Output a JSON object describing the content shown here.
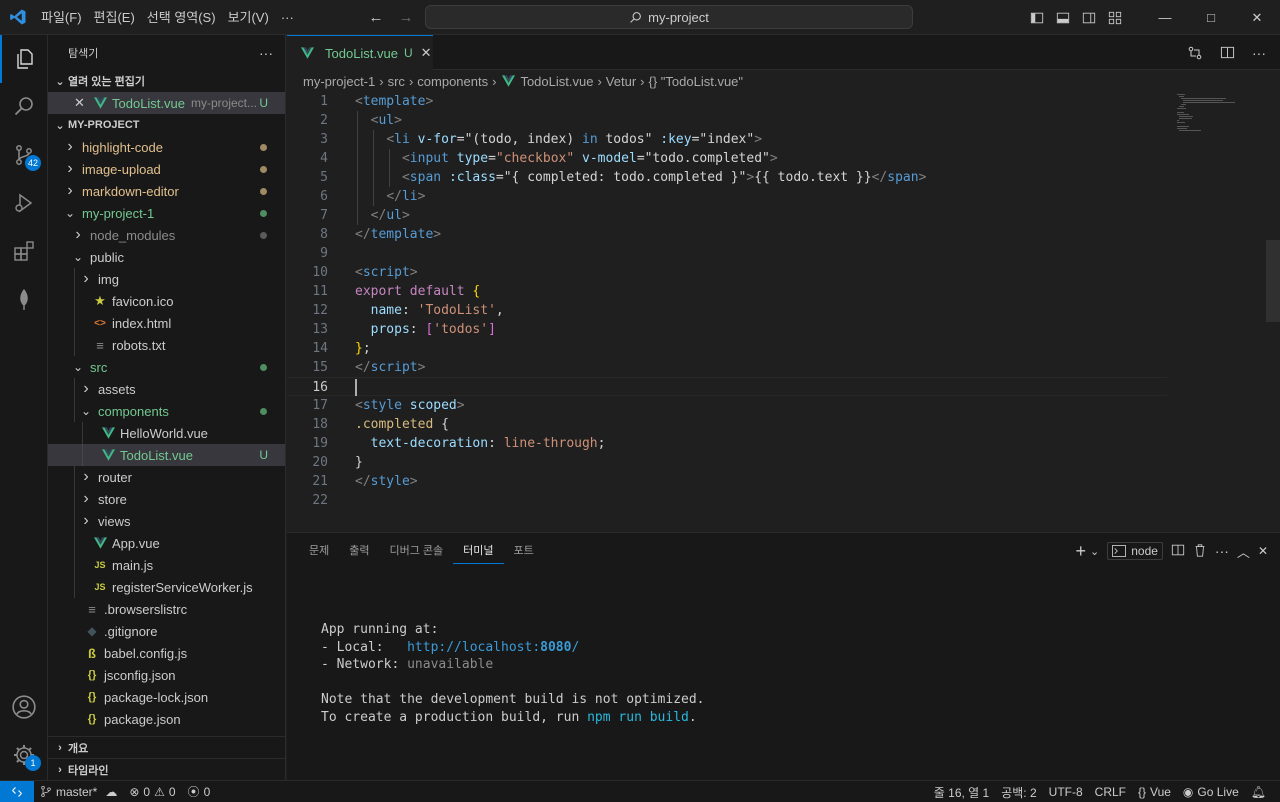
{
  "titlebar": {
    "menus": [
      "파일(F)",
      "편집(E)",
      "선택 영역(S)",
      "보기(V)",
      "···"
    ],
    "search_text": "my-project"
  },
  "activitybar": {
    "source_control_badge": "42",
    "settings_badge": "1"
  },
  "explorer": {
    "title": "탐색기",
    "open_editors_label": "열려 있는 편집기",
    "open_editor": {
      "name": "TodoList.vue",
      "desc": "my-project...",
      "status": "U"
    },
    "project_label": "MY-PROJECT",
    "outline_label": "개요",
    "timeline_label": "타임라인",
    "tree": [
      {
        "name": "highlight-code",
        "type": "folder",
        "indent": 0,
        "color": "orange",
        "dot": "#a08a63"
      },
      {
        "name": "image-upload",
        "type": "folder",
        "indent": 0,
        "color": "orange",
        "dot": "#a08a63"
      },
      {
        "name": "markdown-editor",
        "type": "folder",
        "indent": 0,
        "color": "orange",
        "dot": "#a08a63"
      },
      {
        "name": "my-project-1",
        "type": "folder-open",
        "indent": 0,
        "color": "green",
        "dot": "#4f8e60"
      },
      {
        "name": "node_modules",
        "type": "folder",
        "indent": 1,
        "color": "grey",
        "dot": "#5a5a5a"
      },
      {
        "name": "public",
        "type": "folder-open",
        "indent": 1,
        "color": "plain"
      },
      {
        "name": "img",
        "type": "folder",
        "indent": 2,
        "color": "plain"
      },
      {
        "name": "favicon.ico",
        "type": "file",
        "icon": "star",
        "indent": 2,
        "color": "plain"
      },
      {
        "name": "index.html",
        "type": "file",
        "icon": "html",
        "indent": 2,
        "color": "plain"
      },
      {
        "name": "robots.txt",
        "type": "file",
        "icon": "lines",
        "indent": 2,
        "color": "plain"
      },
      {
        "name": "src",
        "type": "folder-open",
        "indent": 1,
        "color": "green",
        "dot": "#4f8e60"
      },
      {
        "name": "assets",
        "type": "folder",
        "indent": 2,
        "color": "plain"
      },
      {
        "name": "components",
        "type": "folder-open",
        "indent": 2,
        "color": "green",
        "dot": "#4f8e60"
      },
      {
        "name": "HelloWorld.vue",
        "type": "file",
        "icon": "vue",
        "indent": 3,
        "color": "plain"
      },
      {
        "name": "TodoList.vue",
        "type": "file",
        "icon": "vue",
        "indent": 3,
        "color": "green",
        "status": "U",
        "selected": true
      },
      {
        "name": "router",
        "type": "folder",
        "indent": 2,
        "color": "plain"
      },
      {
        "name": "store",
        "type": "folder",
        "indent": 2,
        "color": "plain"
      },
      {
        "name": "views",
        "type": "folder",
        "indent": 2,
        "color": "plain"
      },
      {
        "name": "App.vue",
        "type": "file",
        "icon": "vue",
        "indent": 2,
        "color": "plain"
      },
      {
        "name": "main.js",
        "type": "file",
        "icon": "js",
        "indent": 2,
        "color": "plain"
      },
      {
        "name": "registerServiceWorker.js",
        "type": "file",
        "icon": "js",
        "indent": 2,
        "color": "plain"
      },
      {
        "name": ".browserslistrc",
        "type": "file",
        "icon": "lines",
        "indent": 1,
        "color": "plain"
      },
      {
        "name": ".gitignore",
        "type": "file",
        "icon": "git",
        "indent": 1,
        "color": "plain"
      },
      {
        "name": "babel.config.js",
        "type": "file",
        "icon": "babel",
        "indent": 1,
        "color": "plain"
      },
      {
        "name": "jsconfig.json",
        "type": "file",
        "icon": "json",
        "indent": 1,
        "color": "plain"
      },
      {
        "name": "package-lock.json",
        "type": "file",
        "icon": "json",
        "indent": 1,
        "color": "plain"
      },
      {
        "name": "package.json",
        "type": "file",
        "icon": "json",
        "indent": 1,
        "color": "plain"
      }
    ]
  },
  "editor": {
    "tab_name": "TodoList.vue",
    "tab_status": "U",
    "breadcrumb": [
      "my-project-1",
      "src",
      "components",
      "TodoList.vue",
      "Vetur",
      "{} \"TodoList.vue\""
    ],
    "current_line": 16,
    "lines": [
      [
        [
          "t-br",
          "<"
        ],
        [
          "t-tag",
          "template"
        ],
        [
          "t-br",
          ">"
        ]
      ],
      [
        [
          "t-plain",
          "  "
        ],
        [
          "t-br",
          "<"
        ],
        [
          "t-tag",
          "ul"
        ],
        [
          "t-br",
          ">"
        ]
      ],
      [
        [
          "t-plain",
          "    "
        ],
        [
          "t-br",
          "<"
        ],
        [
          "t-tag",
          "li"
        ],
        [
          "t-plain",
          " "
        ],
        [
          "t-attr",
          "v-for"
        ],
        [
          "t-plain",
          "="
        ],
        [
          "t-plain",
          "\"(todo, index) "
        ],
        [
          "t-key",
          "in"
        ],
        [
          "t-plain",
          " todos\""
        ],
        [
          "t-plain",
          " "
        ],
        [
          "t-attr",
          ":key"
        ],
        [
          "t-plain",
          "=\"index\""
        ],
        [
          "t-br",
          ">"
        ]
      ],
      [
        [
          "t-plain",
          "      "
        ],
        [
          "t-br",
          "<"
        ],
        [
          "t-tag",
          "input"
        ],
        [
          "t-plain",
          " "
        ],
        [
          "t-attr",
          "type"
        ],
        [
          "t-plain",
          "="
        ],
        [
          "t-str",
          "\"checkbox\""
        ],
        [
          "t-plain",
          " "
        ],
        [
          "t-attr",
          "v-model"
        ],
        [
          "t-plain",
          "=\"todo.completed\""
        ],
        [
          "t-br",
          ">"
        ]
      ],
      [
        [
          "t-plain",
          "      "
        ],
        [
          "t-br",
          "<"
        ],
        [
          "t-tag",
          "span"
        ],
        [
          "t-plain",
          " "
        ],
        [
          "t-attr",
          ":class"
        ],
        [
          "t-plain",
          "=\"{ completed: todo.completed }\""
        ],
        [
          "t-br",
          ">"
        ],
        [
          "t-plain",
          "{{ todo.text }}"
        ],
        [
          "t-br",
          "</"
        ],
        [
          "t-tag",
          "span"
        ],
        [
          "t-br",
          ">"
        ]
      ],
      [
        [
          "t-plain",
          "    "
        ],
        [
          "t-br",
          "</"
        ],
        [
          "t-tag",
          "li"
        ],
        [
          "t-br",
          ">"
        ]
      ],
      [
        [
          "t-plain",
          "  "
        ],
        [
          "t-br",
          "</"
        ],
        [
          "t-tag",
          "ul"
        ],
        [
          "t-br",
          ">"
        ]
      ],
      [
        [
          "t-br",
          "</"
        ],
        [
          "t-tag",
          "template"
        ],
        [
          "t-br",
          ">"
        ]
      ],
      [],
      [
        [
          "t-br",
          "<"
        ],
        [
          "t-tag",
          "script"
        ],
        [
          "t-br",
          ">"
        ]
      ],
      [
        [
          "t-kw",
          "export"
        ],
        [
          "t-plain",
          " "
        ],
        [
          "t-kw",
          "default"
        ],
        [
          "t-plain",
          " "
        ],
        [
          "t-brace",
          "{"
        ]
      ],
      [
        [
          "t-plain",
          "  "
        ],
        [
          "t-prop",
          "name"
        ],
        [
          "t-plain",
          ": "
        ],
        [
          "t-str",
          "'TodoList'"
        ],
        [
          "t-plain",
          ","
        ]
      ],
      [
        [
          "t-plain",
          "  "
        ],
        [
          "t-prop",
          "props"
        ],
        [
          "t-plain",
          ": "
        ],
        [
          "t-brace2",
          "["
        ],
        [
          "t-str",
          "'todos'"
        ],
        [
          "t-brace2",
          "]"
        ]
      ],
      [
        [
          "t-brace",
          "}"
        ],
        [
          "t-plain",
          ";"
        ]
      ],
      [
        [
          "t-br",
          "</"
        ],
        [
          "t-tag",
          "script"
        ],
        [
          "t-br",
          ">"
        ]
      ],
      [],
      [
        [
          "t-br",
          "<"
        ],
        [
          "t-tag",
          "style"
        ],
        [
          "t-plain",
          " "
        ],
        [
          "t-attr",
          "scoped"
        ],
        [
          "t-br",
          ">"
        ]
      ],
      [
        [
          "t-sel",
          ".completed"
        ],
        [
          "t-plain",
          " {"
        ]
      ],
      [
        [
          "t-plain",
          "  "
        ],
        [
          "t-prop",
          "text-decoration"
        ],
        [
          "t-plain",
          ": "
        ],
        [
          "t-str",
          "line-through"
        ],
        [
          "t-plain",
          ";"
        ]
      ],
      [
        [
          "t-plain",
          "}"
        ]
      ],
      [
        [
          "t-br",
          "</"
        ],
        [
          "t-tag",
          "style"
        ],
        [
          "t-br",
          ">"
        ]
      ],
      []
    ]
  },
  "panel": {
    "tabs": [
      "문제",
      "출력",
      "디버그 콘솔",
      "터미널",
      "포트"
    ],
    "active_tab": "터미널",
    "terminal_name": "node",
    "terminal": {
      "l1": "App running at:",
      "l2_label": "- Local:   ",
      "l2_url": "http://localhost:",
      "l2_port": "8080",
      "l2_end": "/",
      "l3_label": "- Network: ",
      "l3_value": "unavailable",
      "l4": "Note that the development build is not optimized.",
      "l5_pre": "To create a production build, run ",
      "l5_cmd": "npm run build",
      "l5_end": "."
    }
  },
  "statusbar": {
    "branch": "master*",
    "errors": "0",
    "warnings": "0",
    "ports": "0",
    "position": "줄 16, 열 1",
    "spaces": "공백: 2",
    "encoding": "UTF-8",
    "eol": "CRLF",
    "language": "Vue",
    "golive": "Go Live"
  }
}
